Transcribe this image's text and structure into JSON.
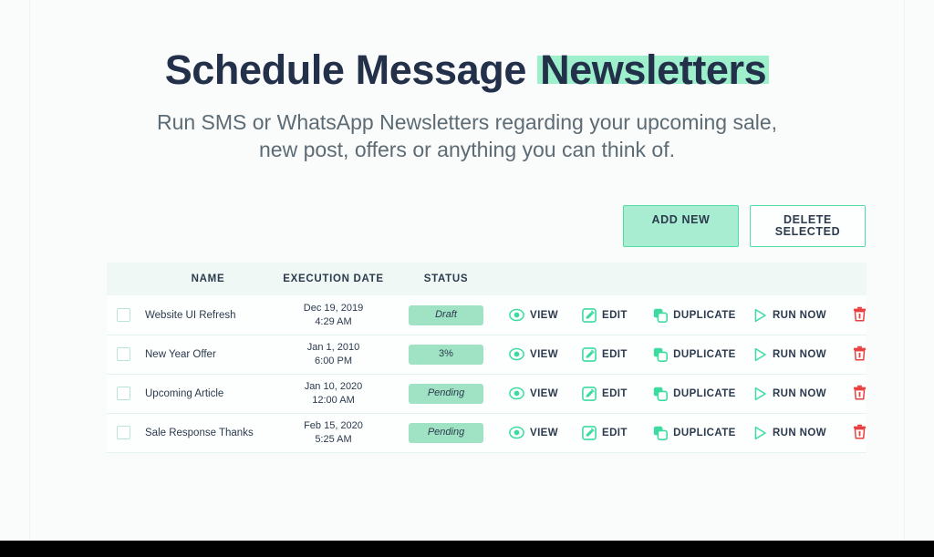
{
  "hero": {
    "title_plain": "Schedule Message ",
    "title_highlight": "Newsletters",
    "subtitle_line1": "Run SMS or WhatsApp Newsletters regarding your upcoming sale,",
    "subtitle_line2": "new post, offers or anything you can think of."
  },
  "toolbar": {
    "add_new_label": "ADD NEW",
    "delete_selected_label": "DELETE SELECTED"
  },
  "table": {
    "headers": {
      "name": "NAME",
      "execution_date": "EXECUTION DATE",
      "status": "STATUS"
    },
    "actions": {
      "view": "VIEW",
      "edit": "EDIT",
      "duplicate": "DUPLICATE",
      "run_now": "RUN NOW"
    },
    "rows": [
      {
        "name": "Website UI Refresh",
        "date": "Dec 19, 2019",
        "time": "4:29 AM",
        "status": "Draft",
        "status_style": "italic"
      },
      {
        "name": "New Year Offer",
        "date": "Jan 1, 2010",
        "time": "6:00 PM",
        "status": "3%",
        "status_style": "normal"
      },
      {
        "name": "Upcoming Article",
        "date": "Jan 10, 2020",
        "time": "12:00 AM",
        "status": "Pending",
        "status_style": "italic"
      },
      {
        "name": "Sale Response Thanks",
        "date": "Feb 15, 2020",
        "time": "5:25 AM",
        "status": "Pending",
        "status_style": "italic"
      }
    ]
  },
  "icons": {
    "view": "eye-icon",
    "edit": "pencil-square-icon",
    "duplicate": "copy-icon",
    "run_now": "play-triangle-icon",
    "delete": "trash-icon",
    "checkbox": "checkbox-icon"
  },
  "colors": {
    "accent_green": "#3ddba0",
    "mint_fill": "#9fe3c4",
    "highlight": "#9ef0cd",
    "text_dark": "#2b3a4d",
    "danger_red": "#e8413f",
    "page_bg": "#fafbfb"
  }
}
